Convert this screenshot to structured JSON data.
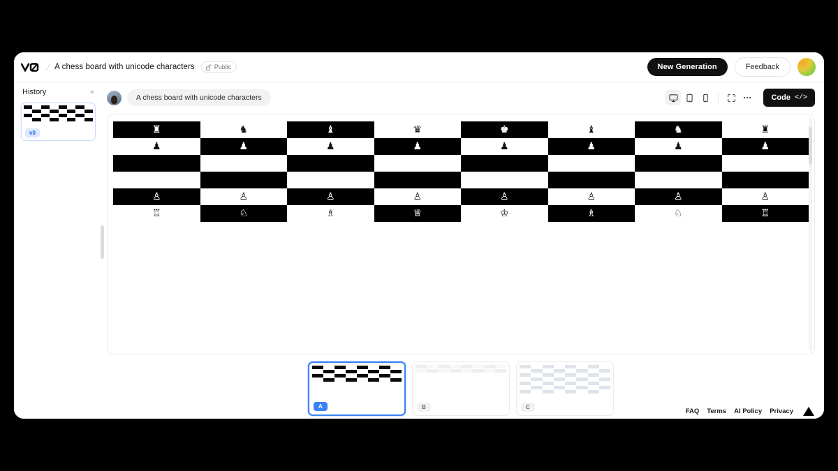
{
  "topbar": {
    "logo": "v0-logo",
    "separator": "/",
    "project_title": "A chess board with unicode characters",
    "visibility_label": "Public",
    "visibility_icon": "lock-open-icon",
    "new_generation_label": "New Generation",
    "feedback_label": "Feedback",
    "avatar": "user-avatar-gradient"
  },
  "sidebar": {
    "title": "History",
    "collapse_icon": "chevron-double-left-icon",
    "collapse_glyph": "«",
    "items": [
      {
        "version_label": "v0",
        "selected": true
      }
    ]
  },
  "prompt": {
    "avatar": "user-avatar-photo",
    "text": "A chess board with unicode characters"
  },
  "viewport_tools": [
    {
      "name": "desktop-view",
      "icon": "monitor-icon",
      "active": true
    },
    {
      "name": "tablet-view",
      "icon": "tablet-icon",
      "active": false
    },
    {
      "name": "mobile-view",
      "icon": "phone-icon",
      "active": false
    },
    {
      "name": "fullscreen",
      "icon": "expand-icon",
      "active": false
    },
    {
      "name": "more-options",
      "icon": "ellipsis-icon",
      "active": false
    }
  ],
  "code_button": {
    "label": "Code",
    "icon": "code-brackets-icon",
    "glyph": "</>"
  },
  "chess": {
    "piece_glyphs": {
      "black_rook": "♜",
      "black_knight": "♞",
      "black_bishop": "♝",
      "black_queen": "♛",
      "black_king": "♚",
      "black_pawn": "♟",
      "white_rook": "♖",
      "white_knight": "♘",
      "white_bishop": "♗",
      "white_queen": "♕",
      "white_king": "♔",
      "white_pawn": "♙",
      "empty": ""
    },
    "rows": [
      {
        "squares": [
          "black_rook",
          "black_knight",
          "black_bishop",
          "black_queen",
          "black_king",
          "black_bishop",
          "black_knight",
          "black_rook"
        ],
        "start": "dark"
      },
      {
        "squares": [
          "black_pawn",
          "black_pawn",
          "black_pawn",
          "black_pawn",
          "black_pawn",
          "black_pawn",
          "black_pawn",
          "black_pawn"
        ],
        "start": "light"
      },
      {
        "squares": [
          "empty",
          "empty",
          "empty",
          "empty",
          "empty",
          "empty",
          "empty",
          "empty"
        ],
        "start": "dark"
      },
      {
        "squares": [
          "empty",
          "empty",
          "empty",
          "empty",
          "empty",
          "empty",
          "empty",
          "empty"
        ],
        "start": "light"
      },
      {
        "squares": [
          "white_pawn",
          "white_pawn",
          "white_pawn",
          "white_pawn",
          "white_pawn",
          "white_pawn",
          "white_pawn",
          "white_pawn"
        ],
        "start": "dark"
      },
      {
        "squares": [
          "white_rook",
          "white_knight",
          "white_bishop",
          "white_queen",
          "white_king",
          "white_bishop",
          "white_knight",
          "white_rook"
        ],
        "start": "light"
      }
    ]
  },
  "variants": [
    {
      "label": "A",
      "selected": true,
      "style": "mono"
    },
    {
      "label": "B",
      "selected": false,
      "style": "gray-top"
    },
    {
      "label": "C",
      "selected": false,
      "style": "gray-grid"
    }
  ],
  "footer": {
    "links": [
      "FAQ",
      "Terms",
      "AI Policy",
      "Privacy"
    ],
    "logo_icon": "vercel-triangle-icon"
  },
  "colors": {
    "accent": "#3b82f6",
    "dark": "#111111",
    "page_bg": "#000000",
    "panel_bg": "#ffffff",
    "board_dark": "#000000",
    "board_light": "#ffffff"
  }
}
